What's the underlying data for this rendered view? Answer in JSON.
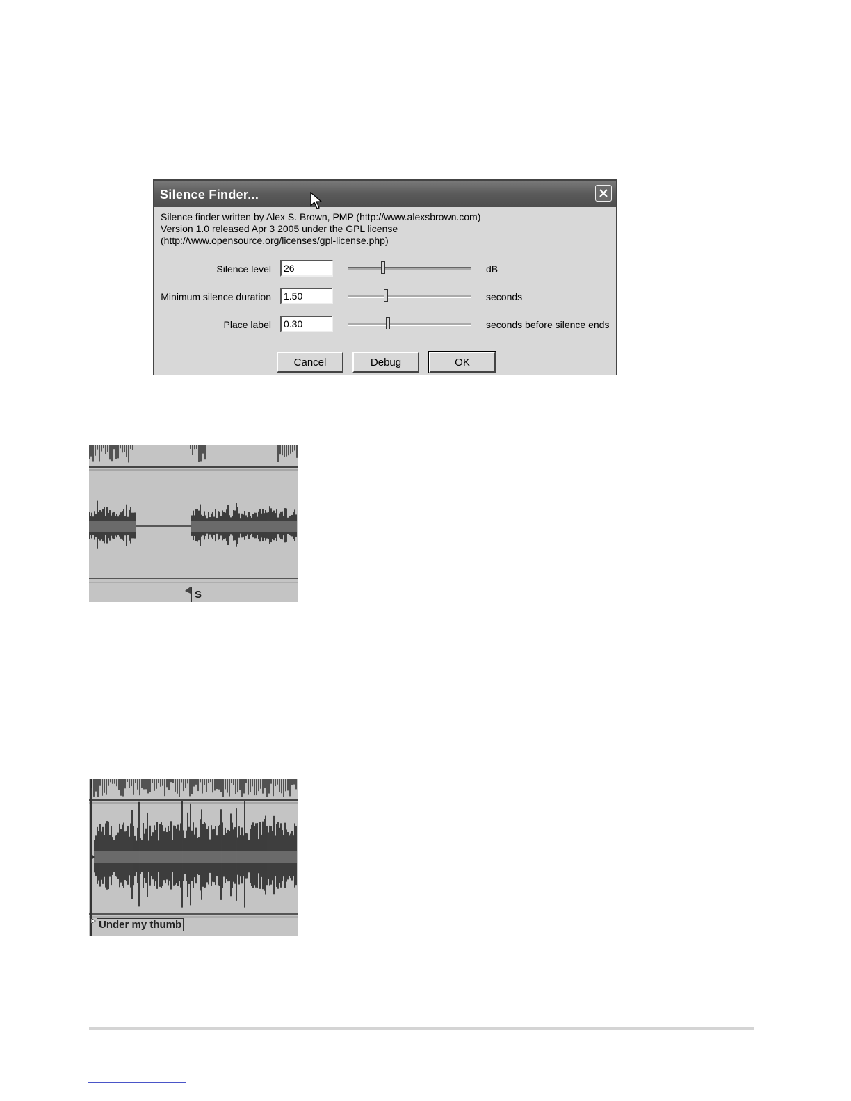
{
  "dialog": {
    "title": "Silence Finder...",
    "info_lines": [
      "Silence finder written by Alex S. Brown, PMP (http://www.alexsbrown.com)",
      "Version 1.0 released Apr 3 2005 under the GPL license",
      "(http://www.opensource.org/licenses/gpl-license.php)"
    ],
    "rows": [
      {
        "label": "Silence level",
        "value": "26",
        "unit": "dB",
        "slider_fraction": 0.28
      },
      {
        "label": "Minimum silence duration",
        "value": "1.50",
        "unit": "seconds",
        "slider_fraction": 0.3
      },
      {
        "label": "Place label",
        "value": "0.30",
        "unit": "seconds before silence ends",
        "slider_fraction": 0.32
      }
    ],
    "buttons": {
      "cancel": "Cancel",
      "debug": "Debug",
      "ok": "OK"
    }
  },
  "waveform_top": {
    "label": "S"
  },
  "waveform_bottom": {
    "label": "Under my thumb"
  }
}
